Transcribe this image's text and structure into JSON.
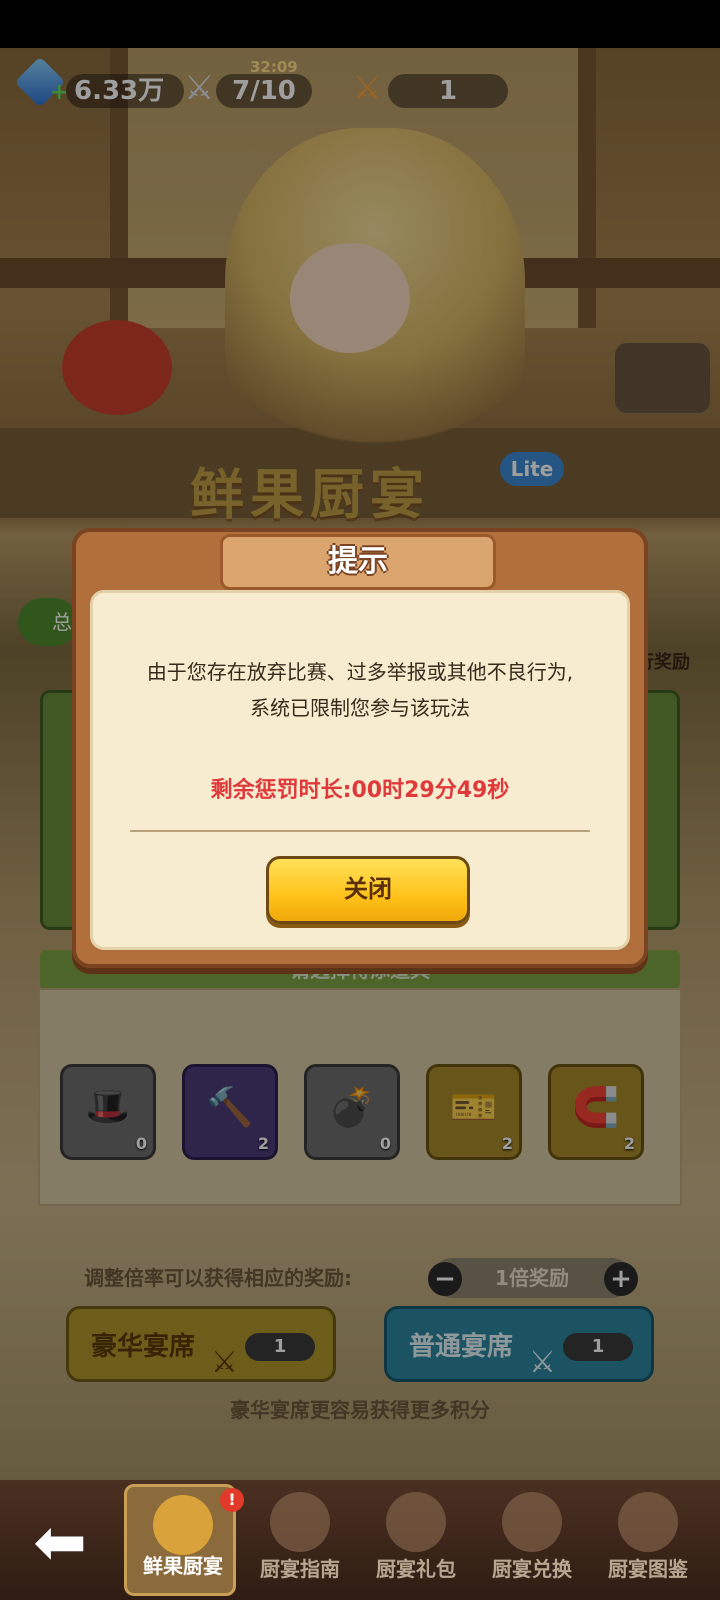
{
  "hud": {
    "gems": "6.33万",
    "timer": "32:09",
    "knives": "7/10",
    "tickets": "1"
  },
  "background": {
    "logo": "鲜果厨宴",
    "lite_badge": "Lite",
    "side_badge_left": "总",
    "side_reward": "行奖励",
    "choose_text": "请选择待添道具",
    "items": [
      {
        "icon": "chef-hat-icon",
        "count": "0"
      },
      {
        "icon": "hammer-icon",
        "count": "2"
      },
      {
        "icon": "bomb-icon",
        "count": "0"
      },
      {
        "icon": "ticket-icon",
        "count": "2"
      },
      {
        "icon": "magnet-icon",
        "count": "2"
      }
    ],
    "multiplier_label": "调整倍率可以获得相应的奖励:",
    "multiplier_value": "1倍奖励",
    "minus": "−",
    "plus": "+",
    "deluxe_seat": "豪华宴席",
    "deluxe_count": "1",
    "normal_seat": "普通宴席",
    "normal_count": "1",
    "deluxe_hint": "豪华宴席更容易获得更多积分"
  },
  "modal": {
    "title": "提示",
    "message_line1": "由于您存在放弃比赛、过多举报或其他不良行为,",
    "message_line2": "系统已限制您参与该玩法",
    "penalty": "剩余惩罚时长:00时29分49秒",
    "close_label": "关闭"
  },
  "nav": {
    "back": "⬅",
    "tabs": [
      {
        "label": "鲜果厨宴",
        "active": true
      },
      {
        "label": "厨宴指南",
        "active": false
      },
      {
        "label": "厨宴礼包",
        "active": false
      },
      {
        "label": "厨宴兑换",
        "active": false
      },
      {
        "label": "厨宴图鉴",
        "active": false
      }
    ],
    "alert": "!"
  },
  "colors": {
    "penalty_red": "#e0393b",
    "close_button_yellow": "#ffc21a",
    "modal_brown": "#b16f3c"
  }
}
